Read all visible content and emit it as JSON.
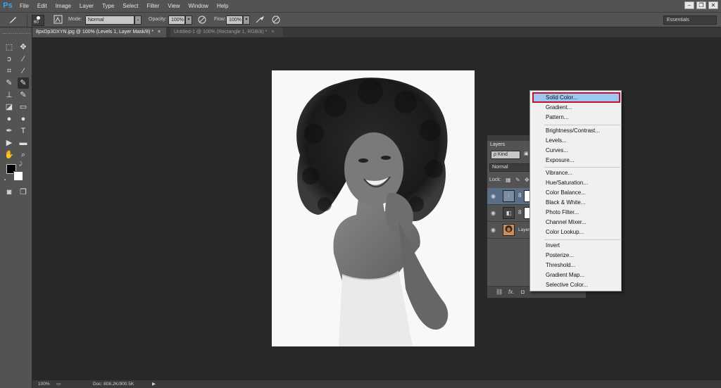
{
  "app": {
    "logo": "Ps"
  },
  "menu": [
    "File",
    "Edit",
    "Image",
    "Layer",
    "Type",
    "Select",
    "Filter",
    "View",
    "Window",
    "Help"
  ],
  "window_controls": [
    "–",
    "❐",
    "✕"
  ],
  "options_bar": {
    "brush_size": "60",
    "mode_label": "Mode:",
    "mode_value": "Normal",
    "opacity_label": "Opacity:",
    "opacity_value": "100%",
    "flow_label": "Flow:",
    "flow_value": "100%",
    "workspace": "Essentials"
  },
  "tabs": [
    {
      "label": "8pxDp3DXYN.jpg @ 100% (Levels 1, Layer Mask/8) *",
      "close": "×"
    },
    {
      "label": "Untitled-1 @ 100% (Rectangle 1, RGB/8) *",
      "close": "×"
    }
  ],
  "layers_panel": {
    "tab": "Layers",
    "filter_label": "ρ Kind",
    "blend_mode": "Normal",
    "lock_label": "Lock:",
    "layer_name": "Layer"
  },
  "adjustment_menu": {
    "group1": [
      "Solid Color...",
      "Gradient...",
      "Pattern..."
    ],
    "group2": [
      "Brightness/Contrast...",
      "Levels...",
      "Curves...",
      "Exposure..."
    ],
    "group3": [
      "Vibrance...",
      "Hue/Saturation...",
      "Color Balance...",
      "Black & White...",
      "Photo Filter...",
      "Channel Mixer...",
      "Color Lookup..."
    ],
    "group4": [
      "Invert",
      "Posterize...",
      "Threshold...",
      "Gradient Map...",
      "Selective Color..."
    ]
  },
  "status": {
    "zoom": "100%",
    "doc": "Doc: 808.2K/900.5K"
  },
  "colors": {
    "highlight": "#9cc8ef",
    "highlight_border": "#c8102e",
    "ps_blue": "#3fa4f0"
  }
}
